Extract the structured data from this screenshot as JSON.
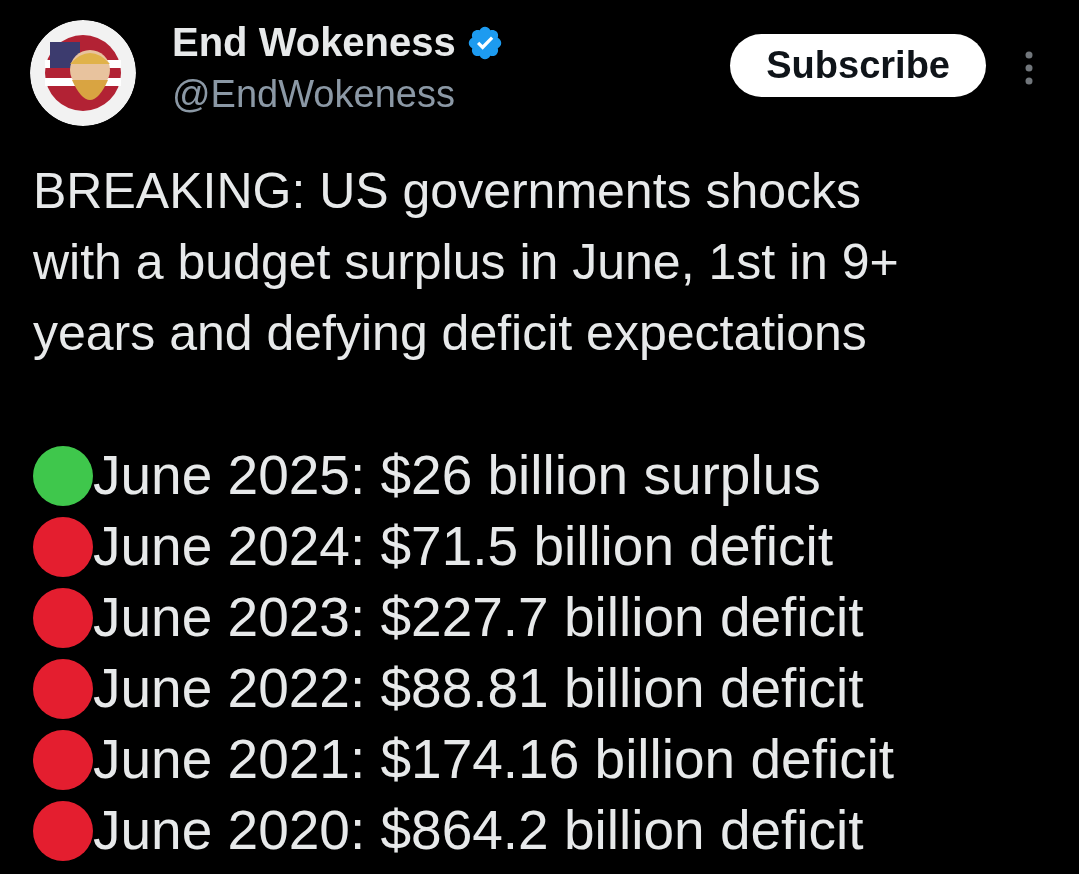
{
  "author": {
    "name": "End Wokeness",
    "verified": true,
    "handle": "@EndWokeness"
  },
  "subscribe_button": "Subscribe",
  "text": "BREAKING: US governments shocks with a budget surplus in June, 1st in 9+ years and defying deficit expectations",
  "items": [
    {
      "text": "June 2025: $26 billion surplus",
      "color": "#3fc74c"
    },
    {
      "text": "June 2024: $71.5 billion deficit",
      "color": "#e41e2f"
    },
    {
      "text": "June 2023: $227.7 billion deficit",
      "color": "#e41e2f"
    },
    {
      "text": "June 2022: $88.81 billion deficit",
      "color": "#e41e2f"
    },
    {
      "text": "June 2021: $174.16 billion deficit",
      "color": "#e41e2f"
    },
    {
      "text": "June 2020: $864.2 billion deficit",
      "color": "#e41e2f"
    }
  ]
}
